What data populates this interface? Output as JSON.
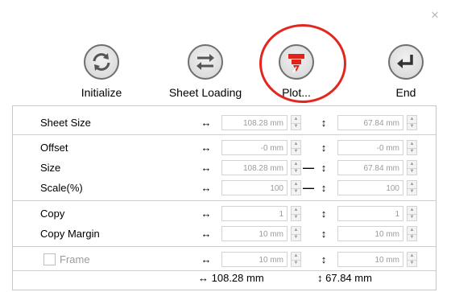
{
  "window": {
    "close_glyph": "×"
  },
  "toolbar": {
    "initialize_label": "Initialize",
    "sheet_loading_label": "Sheet Loading",
    "plot_label": "Plot...",
    "end_label": "End",
    "plot_highlight_color": "#e32620",
    "plot_icon_color": "#e2231a"
  },
  "rows": {
    "sheet_size": {
      "label": "Sheet Size",
      "width": "108.28 mm",
      "height": "67.84 mm"
    },
    "offset": {
      "label": "Offset",
      "width": "-0 mm",
      "height": "-0 mm"
    },
    "size": {
      "label": "Size",
      "width": "108.28 mm",
      "height": "67.84 mm"
    },
    "scale": {
      "label": "Scale(%)",
      "width": "100",
      "height": "100"
    },
    "copy": {
      "label": "Copy",
      "width": "1",
      "height": "1"
    },
    "copy_margin": {
      "label": "Copy Margin",
      "width": "10 mm",
      "height": "10 mm"
    },
    "frame": {
      "label": "Frame",
      "width": "10 mm",
      "height": "10 mm",
      "checked": false
    }
  },
  "totals": {
    "width": "108.28 mm",
    "height": "67.84 mm"
  },
  "glyphs": {
    "horizontal": "↔",
    "vertical": "↕",
    "link": "—",
    "spin_up": "▲",
    "spin_down": "▼"
  }
}
